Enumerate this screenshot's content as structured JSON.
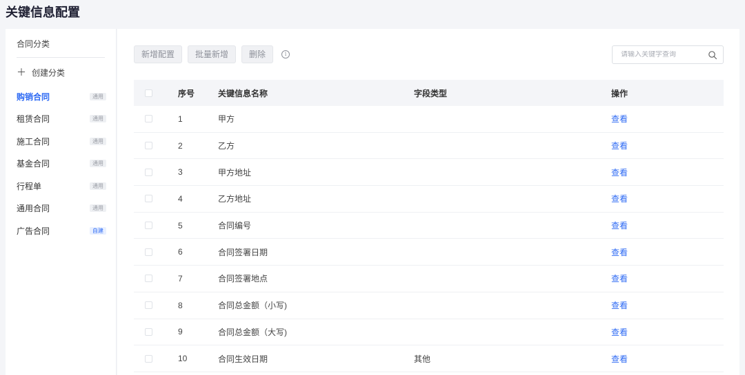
{
  "page": {
    "title": "关键信息配置"
  },
  "sidebar": {
    "header": "合同分类",
    "create_label": "创建分类",
    "items": [
      {
        "label": "购销合同",
        "tag": "通用",
        "active": true
      },
      {
        "label": "租赁合同",
        "tag": "通用"
      },
      {
        "label": "施工合同",
        "tag": "通用"
      },
      {
        "label": "基金合同",
        "tag": "通用"
      },
      {
        "label": "行程单",
        "tag": "通用"
      },
      {
        "label": "通用合同",
        "tag": "通用"
      },
      {
        "label": "广告合同",
        "tag": "自建"
      }
    ]
  },
  "toolbar": {
    "add_label": "新增配置",
    "batch_add_label": "批量新增",
    "delete_label": "删除",
    "info_icon": "i"
  },
  "search": {
    "placeholder": "请输入关键字查询",
    "value": ""
  },
  "table": {
    "headers": {
      "num": "序号",
      "name": "关键信息名称",
      "type": "字段类型",
      "op": "操作"
    },
    "rows": [
      {
        "num": "1",
        "name": "甲方",
        "type": "",
        "op": "查看"
      },
      {
        "num": "2",
        "name": "乙方",
        "type": "",
        "op": "查看"
      },
      {
        "num": "3",
        "name": "甲方地址",
        "type": "",
        "op": "查看"
      },
      {
        "num": "4",
        "name": "乙方地址",
        "type": "",
        "op": "查看"
      },
      {
        "num": "5",
        "name": "合同编号",
        "type": "",
        "op": "查看"
      },
      {
        "num": "6",
        "name": "合同签署日期",
        "type": "",
        "op": "查看"
      },
      {
        "num": "7",
        "name": "合同签署地点",
        "type": "",
        "op": "查看"
      },
      {
        "num": "8",
        "name": "合同总金额（小写)",
        "type": "",
        "op": "查看"
      },
      {
        "num": "9",
        "name": "合同总金额（大写)",
        "type": "",
        "op": "查看"
      },
      {
        "num": "10",
        "name": "合同生效日期",
        "type": "其他",
        "op": "查看"
      }
    ]
  },
  "colors": {
    "accent": "#2f6bf4",
    "custom_tag_bg": "#e9f0ff"
  }
}
